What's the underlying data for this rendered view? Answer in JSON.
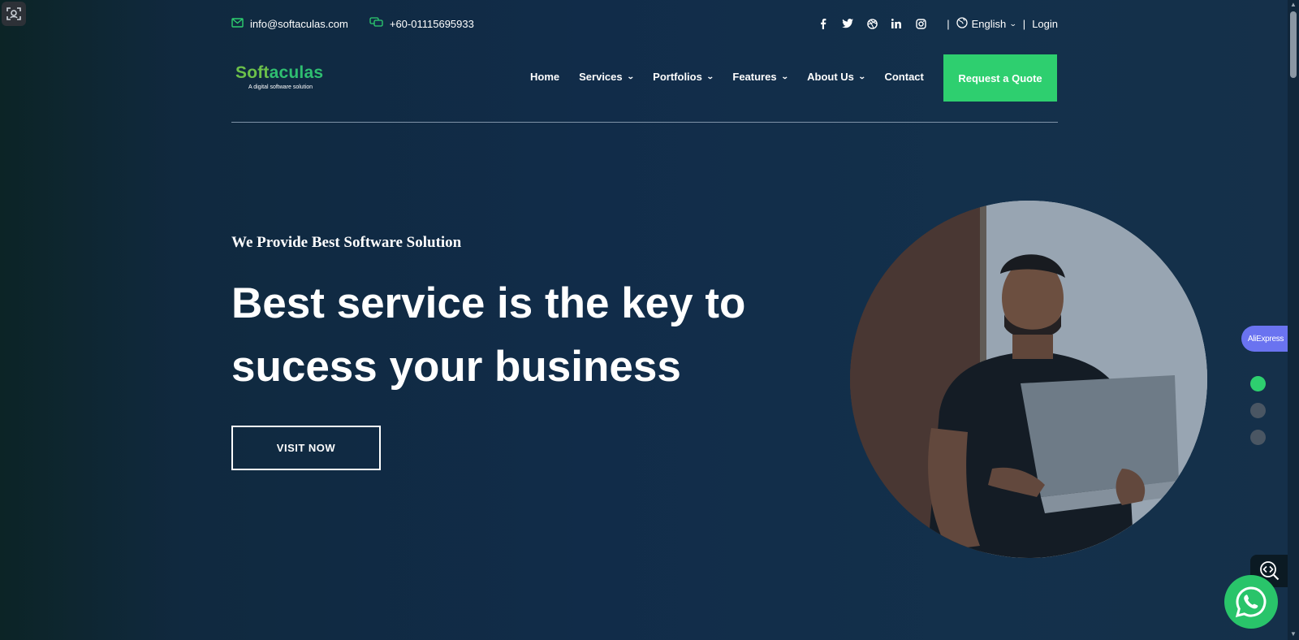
{
  "topbar": {
    "email": "info@softaculas.com",
    "phone": "+60-01115695933",
    "language": "English",
    "separator": "|",
    "login": "Login",
    "social_icons": [
      "facebook-icon",
      "twitter-icon",
      "dribbble-icon",
      "linkedin-icon",
      "instagram-icon"
    ]
  },
  "header": {
    "logo_part1": "Soft",
    "logo_part2": "aculas",
    "logo_tagline": "A digital software solution",
    "nav": [
      {
        "label": "Home",
        "dropdown": false
      },
      {
        "label": "Services",
        "dropdown": true
      },
      {
        "label": "Portfolios",
        "dropdown": true
      },
      {
        "label": "Features",
        "dropdown": true
      },
      {
        "label": "About Us",
        "dropdown": true
      },
      {
        "label": "Contact",
        "dropdown": false
      }
    ],
    "cta": "Request a Quote"
  },
  "hero": {
    "subtitle": "We Provide Best Software Solution",
    "headline": "Best service is the key to sucess your business",
    "button": "VISIT NOW",
    "slides_total": 3,
    "active_slide": 1
  },
  "widgets": {
    "aliexpress": "AliExpress"
  },
  "colors": {
    "accent": "#2ecf6f",
    "background": "#112c49"
  }
}
